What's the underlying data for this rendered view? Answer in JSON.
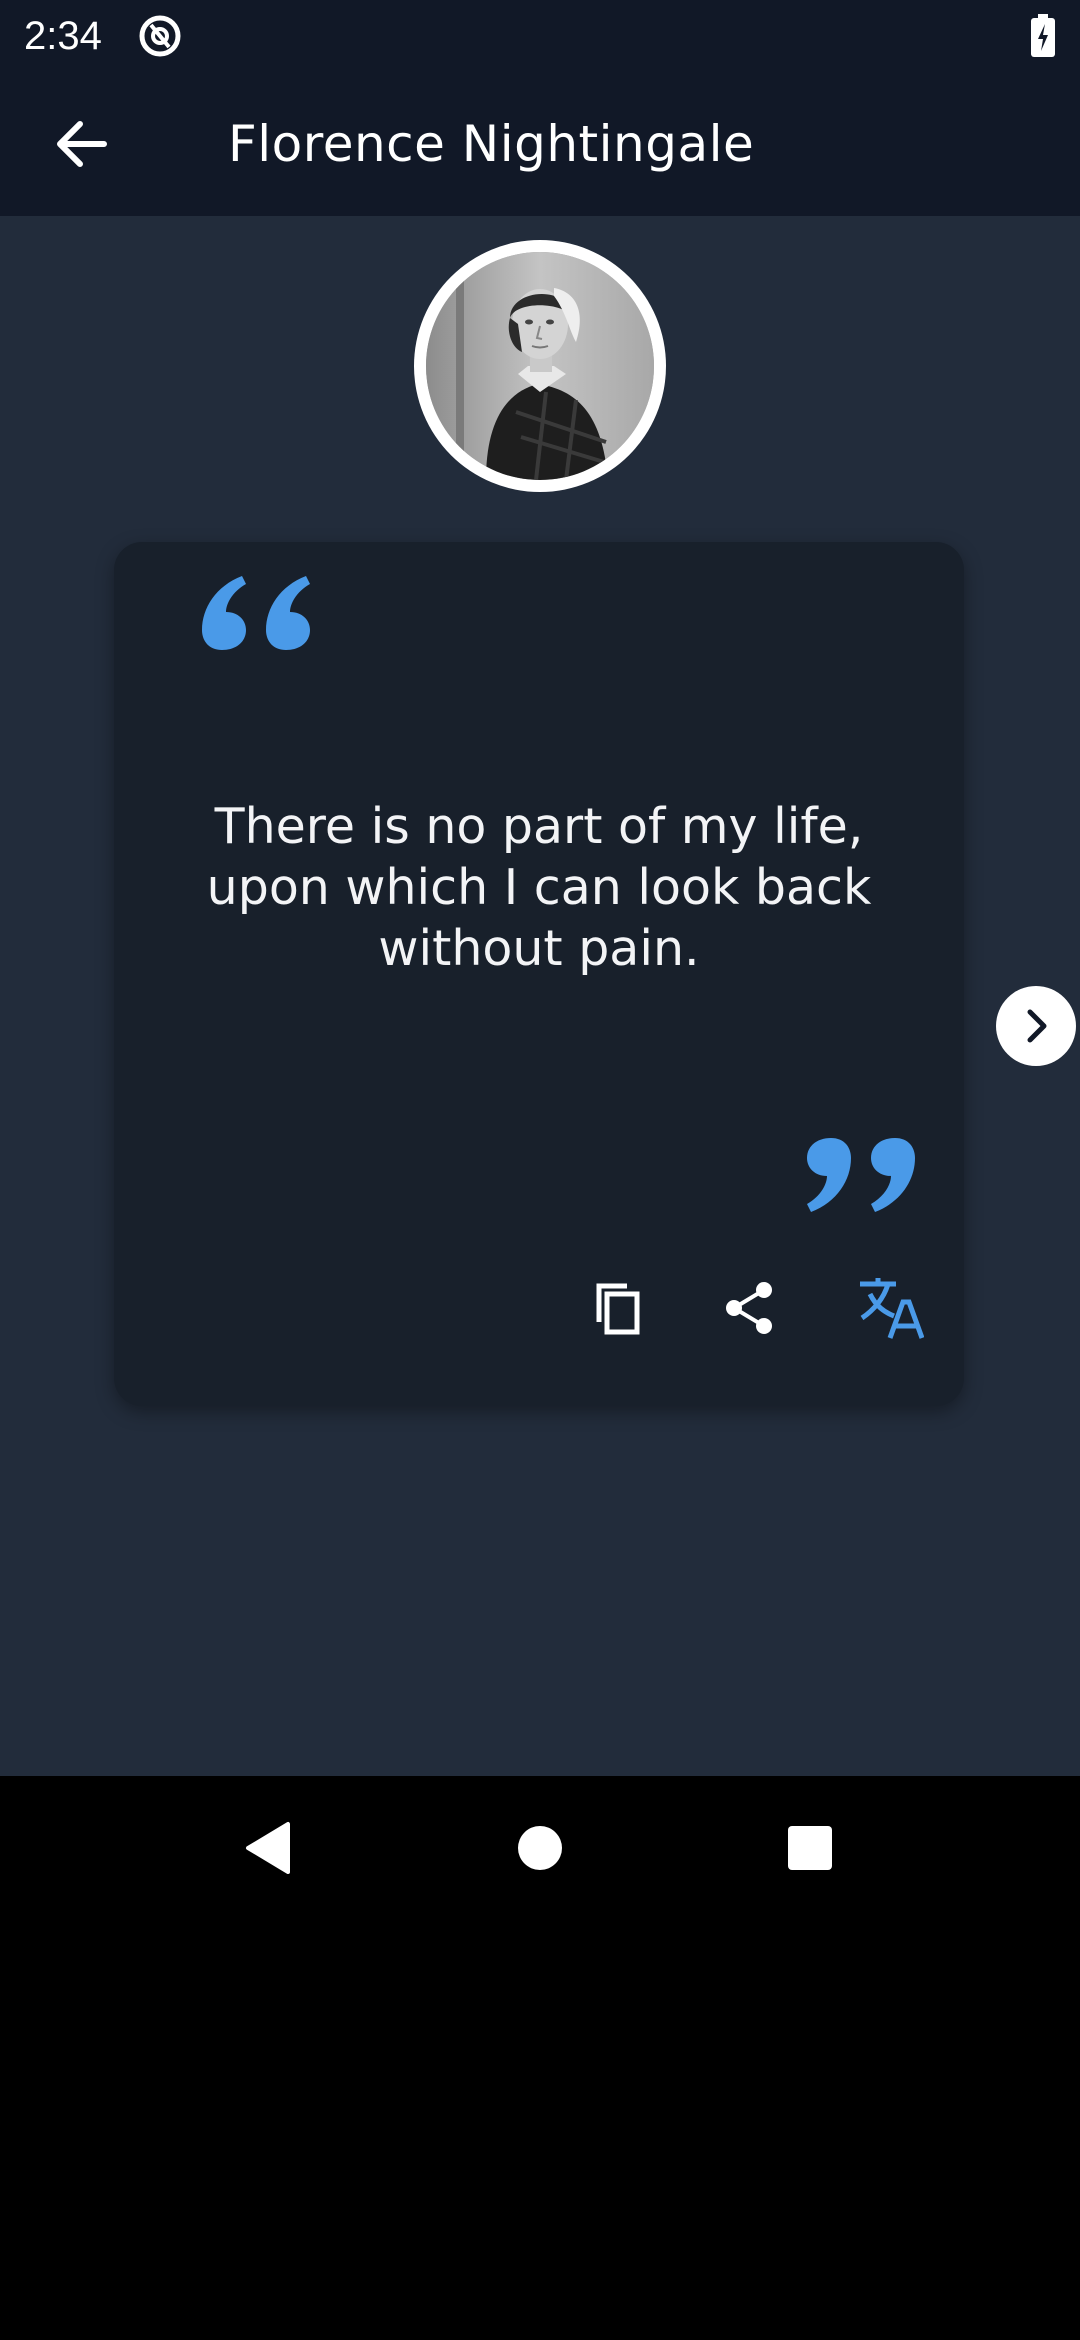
{
  "status_bar": {
    "time": "2:34",
    "app_icon": "at-sign-icon",
    "battery_icon": "battery-charging-icon"
  },
  "app_bar": {
    "back_icon": "arrow-back-icon",
    "title": "Florence Nightingale"
  },
  "author": {
    "avatar": "author-portrait"
  },
  "quote": {
    "text": "There is no part of my life, upon which I can look back without pain.",
    "open_quote_icon": "open-quote-icon",
    "close_quote_icon": "close-quote-icon",
    "actions": [
      {
        "name": "copy",
        "icon": "copy-icon"
      },
      {
        "name": "share",
        "icon": "share-icon"
      },
      {
        "name": "translate",
        "icon": "translate-icon"
      }
    ]
  },
  "next": {
    "icon": "chevron-right-icon"
  },
  "nav_bar": {
    "back_icon": "nav-back-icon",
    "home_icon": "nav-home-icon",
    "recents_icon": "nav-recents-icon"
  },
  "colors": {
    "app_bar": "#111827",
    "background": "#222c3b",
    "card": "#18202b",
    "accent": "#4a9ae8",
    "text": "#f3f4f6"
  }
}
